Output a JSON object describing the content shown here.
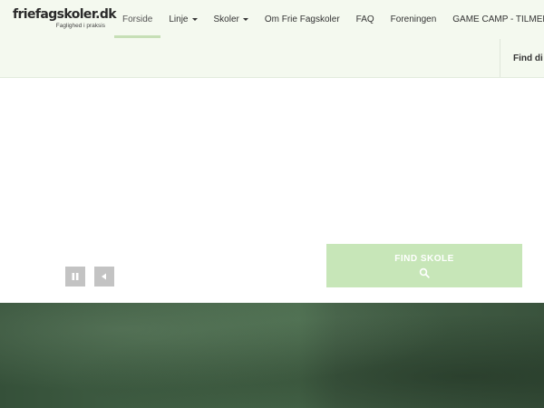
{
  "logo": {
    "title": "friefagskoler.dk",
    "subtitle": "Faglighed i praksis"
  },
  "nav": {
    "items": [
      {
        "label": "Forside",
        "active": true,
        "dropdown": false
      },
      {
        "label": "Linje",
        "active": false,
        "dropdown": true
      },
      {
        "label": "Skoler",
        "active": false,
        "dropdown": true
      },
      {
        "label": "Om Frie Fagskoler",
        "active": false,
        "dropdown": false
      },
      {
        "label": "FAQ",
        "active": false,
        "dropdown": false
      },
      {
        "label": "Foreningen",
        "active": false,
        "dropdown": false
      },
      {
        "label": "GAME CAMP - TILMELDIN",
        "active": false,
        "dropdown": false
      }
    ],
    "secondary_label": "Find di"
  },
  "slider": {
    "pause_icon": "pause-icon",
    "prev_icon": "triangle-left-icon"
  },
  "cta": {
    "label": "FIND SKOLE",
    "icon": "search-icon"
  },
  "colors": {
    "header_bg": "#f4f9ef",
    "active_underline": "#c6dfb6",
    "cta_bg": "#c7e6b8",
    "control_bg": "#c3c3c3",
    "hero_bg": "#3f5a43"
  }
}
